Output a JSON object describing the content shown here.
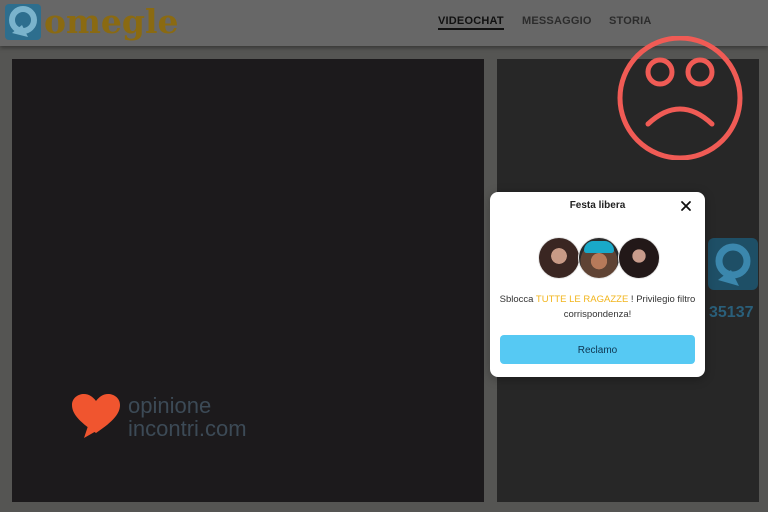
{
  "header": {
    "logo_text": "omegle",
    "nav": [
      {
        "label": "VIDEOCHAT",
        "active": true
      },
      {
        "label": "MESSAGGIO",
        "active": false
      },
      {
        "label": "STORIA",
        "active": false
      }
    ]
  },
  "side_panel": {
    "user_count": "35137"
  },
  "watermark": {
    "line1": "opinione",
    "line2": "incontri.com"
  },
  "modal": {
    "title": "Festa libera",
    "text_before": "Sblocca ",
    "text_highlight": "TUTTE LE RAGAZZE",
    "text_after": " ! Privilegio filtro corrispondenza!",
    "button_label": "Reclamo"
  },
  "colors": {
    "accent_button": "#56c9f3",
    "highlight": "#f2b51c",
    "sad_face": "#f05b55",
    "logo": "#8a6a12"
  },
  "icons": [
    "omegle-logo-icon",
    "close-icon",
    "sad-face-icon",
    "heart-chat-icon"
  ]
}
